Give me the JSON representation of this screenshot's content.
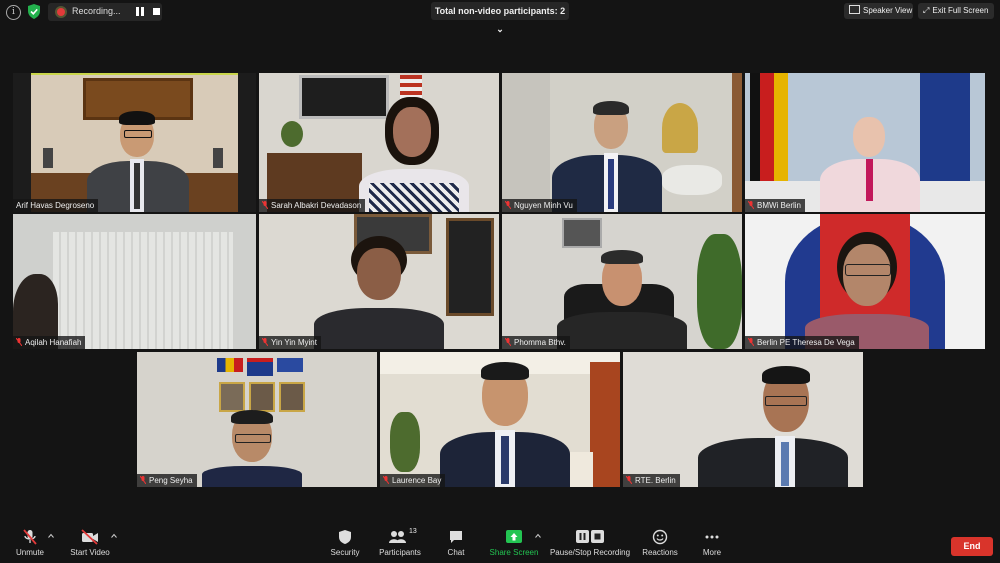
{
  "top_bar": {
    "recording_label": "Recording...",
    "nonvideo_label": "Total non-video participants: 2",
    "speaker_view_label": "Speaker View",
    "exit_fullscreen_label": "Exit Full Screen"
  },
  "participants": [
    {
      "name": "Arif Havas Degroseno",
      "active_speaker": true
    },
    {
      "name": "Sarah Albakri Devadason"
    },
    {
      "name": "Nguyen Minh Vu"
    },
    {
      "name": "BMWi Berlin"
    },
    {
      "name": "Aqilah Hanafiah"
    },
    {
      "name": "Yin Yin Myint"
    },
    {
      "name": "Phomma Bthv."
    },
    {
      "name": "Berlin PE Theresa De Vega"
    },
    {
      "name": "Peng Seyha"
    },
    {
      "name": "Laurence Bay"
    },
    {
      "name": "RTE. Berlin"
    }
  ],
  "toolbar": {
    "unmute_label": "Unmute",
    "start_video_label": "Start Video",
    "security_label": "Security",
    "participants_label": "Participants",
    "participants_count": "13",
    "chat_label": "Chat",
    "share_screen_label": "Share Screen",
    "pause_stop_recording_label": "Pause/Stop Recording",
    "reactions_label": "Reactions",
    "more_label": "More",
    "end_label": "End"
  },
  "colors": {
    "background": "#141414",
    "active_speaker_border": "#c9d54a",
    "share_screen_green": "#23c552",
    "end_red": "#d9342b",
    "recording_red": "#e23a3a"
  }
}
